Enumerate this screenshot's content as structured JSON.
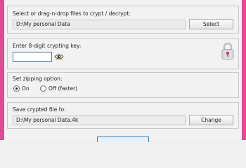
{
  "crypt_section": {
    "label": "Select or drag-n-drop files to crypt / decrypt:",
    "path_value": "D:\\My personal Data",
    "select_label": "Select"
  },
  "key_section": {
    "label": "Enter 8-digit crypting key:",
    "key_value": "",
    "show_key_icon": "eye-icon",
    "lock_icon": "lock-icon"
  },
  "zip_section": {
    "label": "Set zipping option:",
    "options": [
      {
        "label": "On",
        "selected": true
      },
      {
        "label": "Off (faster)",
        "selected": false
      }
    ]
  },
  "save_section": {
    "label": "Save crypted file to:",
    "path_value": "D:\\My personal Data.4k",
    "change_label": "Change"
  },
  "colors": {
    "accent_border": "#e14a97",
    "focus_blue": "#3c7fb1"
  }
}
